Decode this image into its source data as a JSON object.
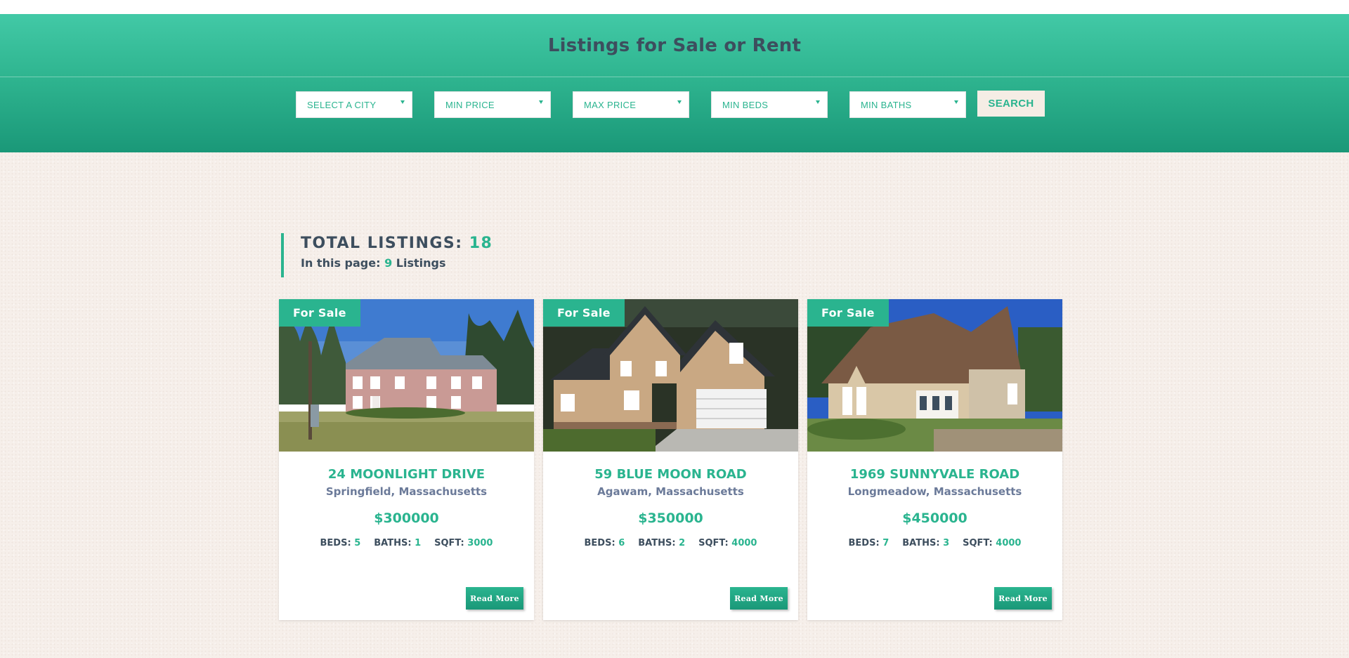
{
  "header": {
    "title": "Listings for Sale or Rent"
  },
  "filters": {
    "city": "SELECT A CITY",
    "min_price": "MIN PRICE",
    "max_price": "MAX PRICE",
    "min_beds": "MIN BEDS",
    "min_baths": "MIN BATHS",
    "search_label": "SEARCH"
  },
  "summary": {
    "total_label": "TOTAL LISTINGS:",
    "total_count": "18",
    "page_prefix": "In this page:",
    "page_count": "9",
    "page_suffix": "Listings"
  },
  "labels": {
    "beds": "BEDS:",
    "baths": "BATHS:",
    "sqft": "SQFT:",
    "read_more": "Read More"
  },
  "listings": [
    {
      "badge": "For Sale",
      "address": "24 MOONLIGHT DRIVE",
      "city": "Springfield, Massachusetts",
      "price": "$300000",
      "beds": "5",
      "baths": "1",
      "sqft": "3000"
    },
    {
      "badge": "For Sale",
      "address": "59 BLUE MOON ROAD",
      "city": "Agawam, Massachusetts",
      "price": "$350000",
      "beds": "6",
      "baths": "2",
      "sqft": "4000"
    },
    {
      "badge": "For Sale",
      "address": "1969 SUNNYVALE ROAD",
      "city": "Longmeadow, Massachusetts",
      "price": "$450000",
      "beds": "7",
      "baths": "3",
      "sqft": "4000"
    }
  ],
  "colors": {
    "accent": "#2ab48f",
    "heading": "#3d4e5e",
    "city_text": "#6b7a99",
    "page_bg": "#f6efea"
  }
}
